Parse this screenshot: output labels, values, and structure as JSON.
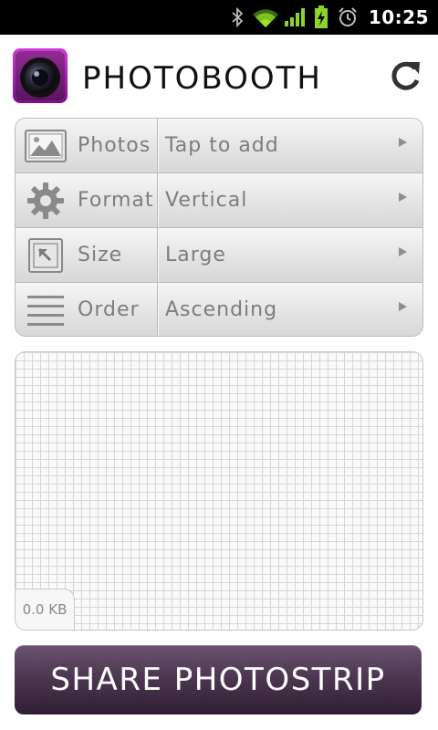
{
  "status_bar": {
    "time": "10:25",
    "icons": [
      "bluetooth-icon",
      "wifi-icon",
      "signal-icon",
      "battery-charging-icon",
      "alarm-icon"
    ]
  },
  "header": {
    "title": "PHOTOBOOTH",
    "logo_icon": "camera-lens-icon",
    "refresh_icon": "refresh-icon"
  },
  "settings": {
    "rows": [
      {
        "label": "Photos",
        "value": "Tap to add",
        "icon": "image-icon"
      },
      {
        "label": "Format",
        "value": "Vertical",
        "icon": "gear-icon"
      },
      {
        "label": "Size",
        "value": "Large",
        "icon": "resize-icon"
      },
      {
        "label": "Order",
        "value": "Ascending",
        "icon": "list-icon"
      }
    ]
  },
  "preview": {
    "size_text": "0.0 KB"
  },
  "share_button": {
    "label": "SHARE PHOTOSTRIP"
  },
  "colors": {
    "accent": "#4d3752",
    "logo_purple": "#b01fb0"
  }
}
